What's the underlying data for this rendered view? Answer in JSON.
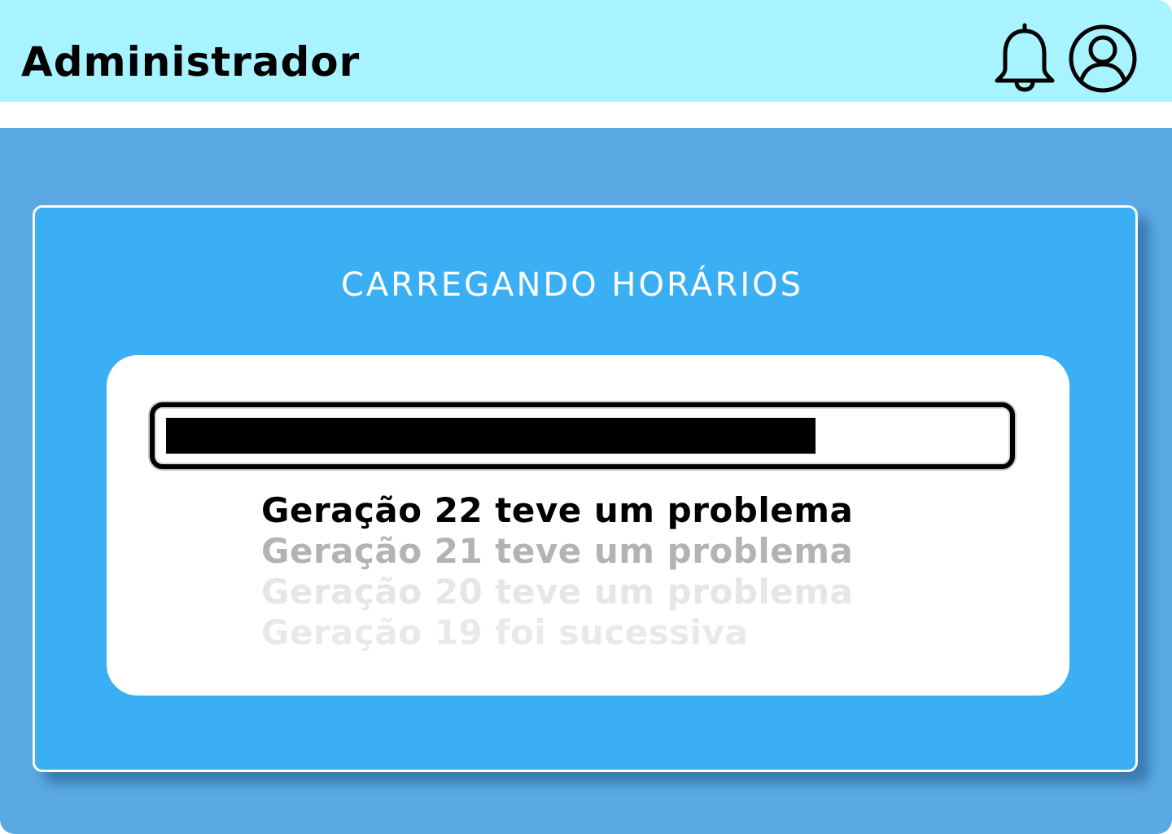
{
  "header": {
    "title": "Administrador",
    "notifications_icon": "bell-icon",
    "profile_icon": "user-circle-icon"
  },
  "colors": {
    "header_bg": "#a7f3ff",
    "page_bg": "#5aa8e4",
    "card_bg": "#3aaff3",
    "panel_bg": "#ffffff"
  },
  "loading": {
    "title": "CARREGANDO HORÁRIOS",
    "progress": 0.78
  },
  "log": [
    {
      "text": "Geração 22 teve um problema"
    },
    {
      "text": "Geração 21 teve um problema"
    },
    {
      "text": "Geração 20 teve um problema"
    },
    {
      "text": "Geração 19 foi sucessiva"
    }
  ]
}
